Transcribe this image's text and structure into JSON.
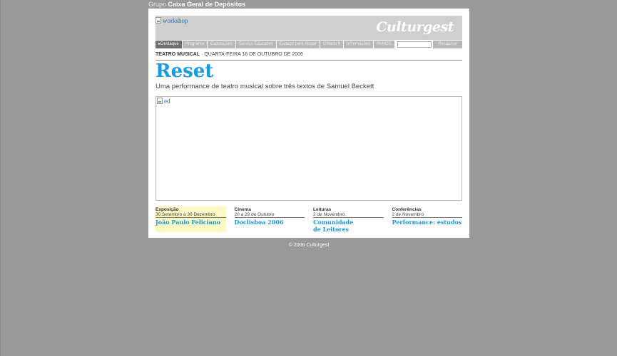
{
  "group_bar": {
    "prefix": "Grupo",
    "name": "Caixa Geral de Depósitos"
  },
  "header": {
    "banner_alt": "workshop",
    "logo": "Culturgest"
  },
  "nav": {
    "items": [
      "Destaque",
      "Programa",
      "Exposições",
      "Serviço Educativo",
      "Espaço para Alugar",
      "Chiado 8",
      "Informações",
      "PANOS"
    ],
    "active_index": 0,
    "search_button": "Pesquisar"
  },
  "event": {
    "category": "TEATRO MUSICAL",
    "date": "· QUARTA-FEIRA 18 DE OUTUBRO DE 2006",
    "title": "Reset",
    "subtitle": "Uma performance de teatro musical sobre três textos de Samuel Beckett",
    "image_alt": "ed"
  },
  "promos": [
    {
      "category": "Exposição",
      "date": "30 Setembro a 30 Dezembro",
      "title": "João Paulo Feliciano",
      "highlight": true
    },
    {
      "category": "Cinema",
      "date": "20 a 29 de Outubro",
      "title": "Doclisboa 2006",
      "highlight": false
    },
    {
      "category": "Leituras",
      "date": "2 de Novembro",
      "title": "Comunidade de Leitores",
      "highlight": false
    },
    {
      "category": "Conferências",
      "date": "2 de Novembro",
      "title": "Performance: estudos",
      "highlight": false
    }
  ],
  "footer": "© 2006 Culturgest",
  "colors": {
    "background": "#999999",
    "accent": "#1a9ae0",
    "highlight": "#fbf8c5"
  }
}
